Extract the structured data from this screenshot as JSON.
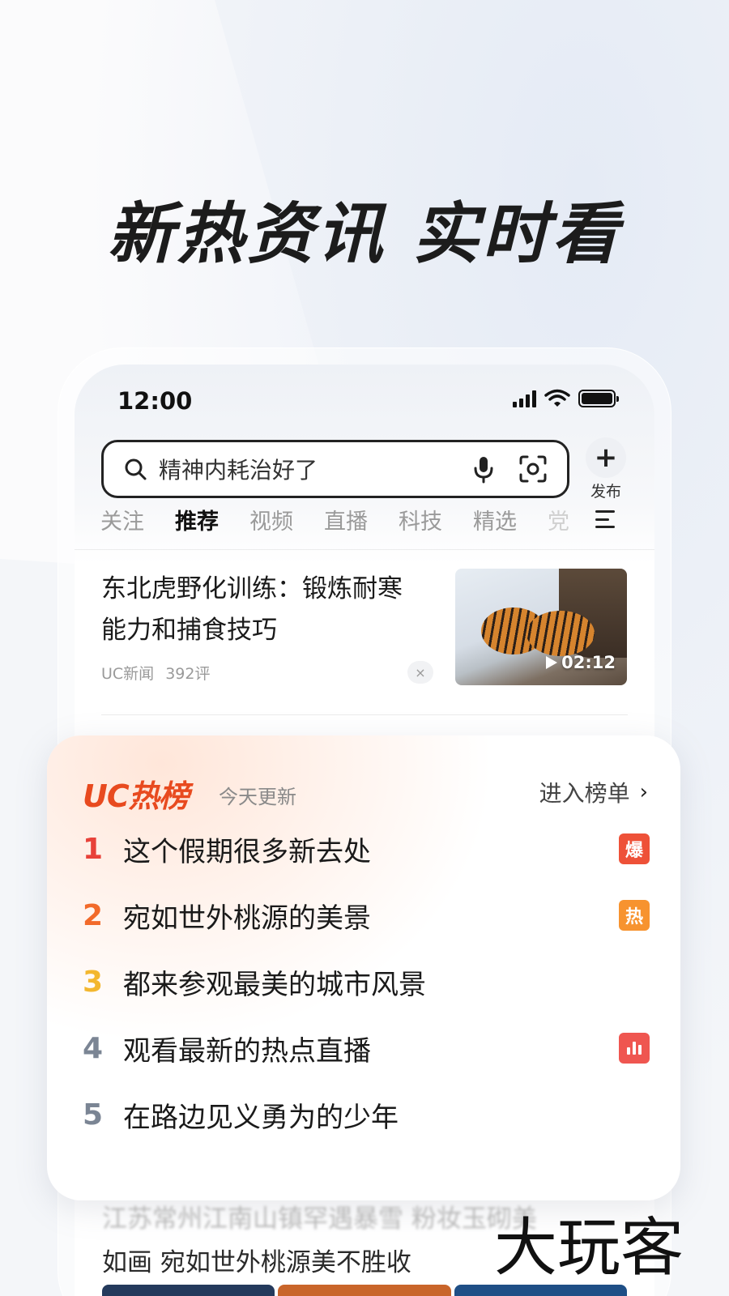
{
  "promo": {
    "headline": "新热资讯 实时看"
  },
  "status_bar": {
    "time": "12:00"
  },
  "search": {
    "query": "精神内耗治好了"
  },
  "publish": {
    "icon": "plus-icon",
    "label": "发布"
  },
  "tabs": [
    {
      "label": "关注",
      "active": false
    },
    {
      "label": "推荐",
      "active": true
    },
    {
      "label": "视频",
      "active": false
    },
    {
      "label": "直播",
      "active": false
    },
    {
      "label": "科技",
      "active": false
    },
    {
      "label": "精选",
      "active": false
    },
    {
      "label": "党",
      "active": false
    }
  ],
  "news": {
    "title": "东北虎野化训练：锻炼耐寒能力和捕食技巧",
    "source": "UC新闻",
    "comments": "392评",
    "close_icon": "×",
    "video_duration": "02:12"
  },
  "hot_list": {
    "logo": "UC热榜",
    "updated": "今天更新",
    "enter": "进入榜单",
    "items": [
      {
        "rank": "1",
        "title": "这个假期很多新去处",
        "tag": "爆",
        "rank_color": "#e8423a",
        "tag_color": "#ee5138"
      },
      {
        "rank": "2",
        "title": "宛如世外桃源的美景",
        "tag": "热",
        "rank_color": "#f26a2a",
        "tag_color": "#f7932f"
      },
      {
        "rank": "3",
        "title": "都来参观最美的城市风景",
        "tag": "",
        "rank_color": "#f3b72f",
        "tag_color": ""
      },
      {
        "rank": "4",
        "title": "观看最新的热点直播",
        "tag": "bar-chart-icon",
        "rank_color": "#7b8594",
        "tag_color": "#ef5650"
      },
      {
        "rank": "5",
        "title": "在路边见义勇为的少年",
        "tag": "",
        "rank_color": "#7b8594",
        "tag_color": ""
      }
    ]
  },
  "bottom_news": {
    "line1": "江苏常州江南山镇罕遇暴雪 粉妆玉砌美",
    "line2": "如画 宛如世外桃源美不胜收"
  },
  "watermark": "大玩客"
}
